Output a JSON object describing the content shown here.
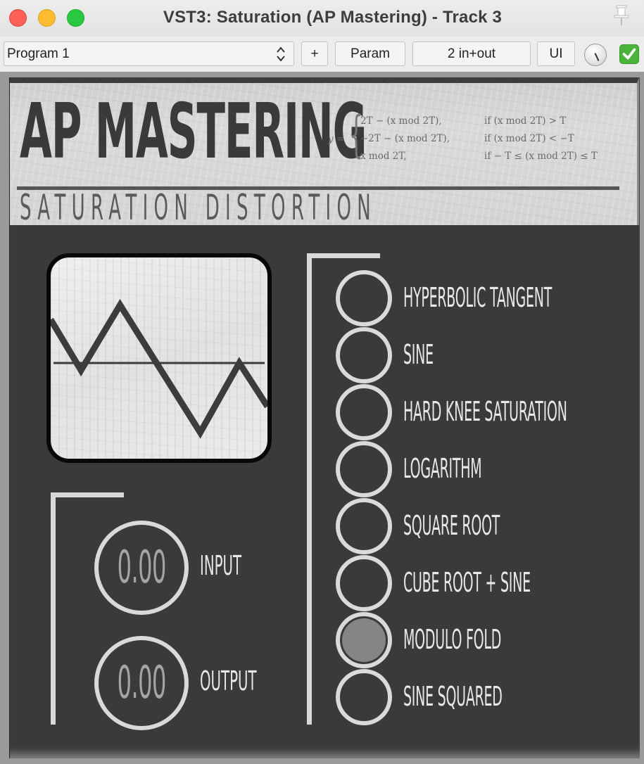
{
  "window": {
    "title": "VST3: Saturation (AP Mastering) - Track 3",
    "controls": [
      "close",
      "minimize",
      "maximize"
    ],
    "pin_icon": "pin-icon"
  },
  "toolbar": {
    "program": "Program 1",
    "plus_label": "+",
    "param_label": "Param",
    "io_label": "2 in+out",
    "ui_label": "UI",
    "knob_icon": "knob-icon",
    "bypass_icon": "checkmark-icon",
    "bypass_enabled": true,
    "accent_color": "#4ab33a"
  },
  "plugin": {
    "brand": "AP MASTERING",
    "subtitle": "SATURATION DISTORTION",
    "formula": {
      "lhs": "y =",
      "cases": [
        {
          "expr": "2T − (x  mod 2T),",
          "cond": "if (x  mod 2T) > T"
        },
        {
          "expr": "−2T − (x  mod 2T),",
          "cond": "if (x  mod 2T) < −T"
        },
        {
          "expr": "x  mod 2T,",
          "cond": "if − T ≤ (x  mod 2T) ≤ T"
        }
      ]
    },
    "scope": {
      "name": "modulo-fold-waveform",
      "waveform": [
        [
          0.0,
          0.3
        ],
        [
          0.14,
          -0.05
        ],
        [
          0.32,
          0.4
        ],
        [
          0.69,
          -0.48
        ],
        [
          0.87,
          0.0
        ],
        [
          1.0,
          -0.3
        ]
      ]
    },
    "gains": [
      {
        "label": "INPUT",
        "value": "0.00"
      },
      {
        "label": "OUTPUT",
        "value": "0.00"
      }
    ],
    "modes": [
      {
        "label": "HYPERBOLIC TANGENT",
        "selected": false
      },
      {
        "label": "SINE",
        "selected": false
      },
      {
        "label": "HARD KNEE SATURATION",
        "selected": false
      },
      {
        "label": "LOGARITHM",
        "selected": false
      },
      {
        "label": "SQUARE ROOT",
        "selected": false
      },
      {
        "label": "CUBE ROOT + SINE",
        "selected": false
      },
      {
        "label": "MODULO FOLD",
        "selected": true
      },
      {
        "label": "SINE SQUARED",
        "selected": false
      }
    ]
  }
}
